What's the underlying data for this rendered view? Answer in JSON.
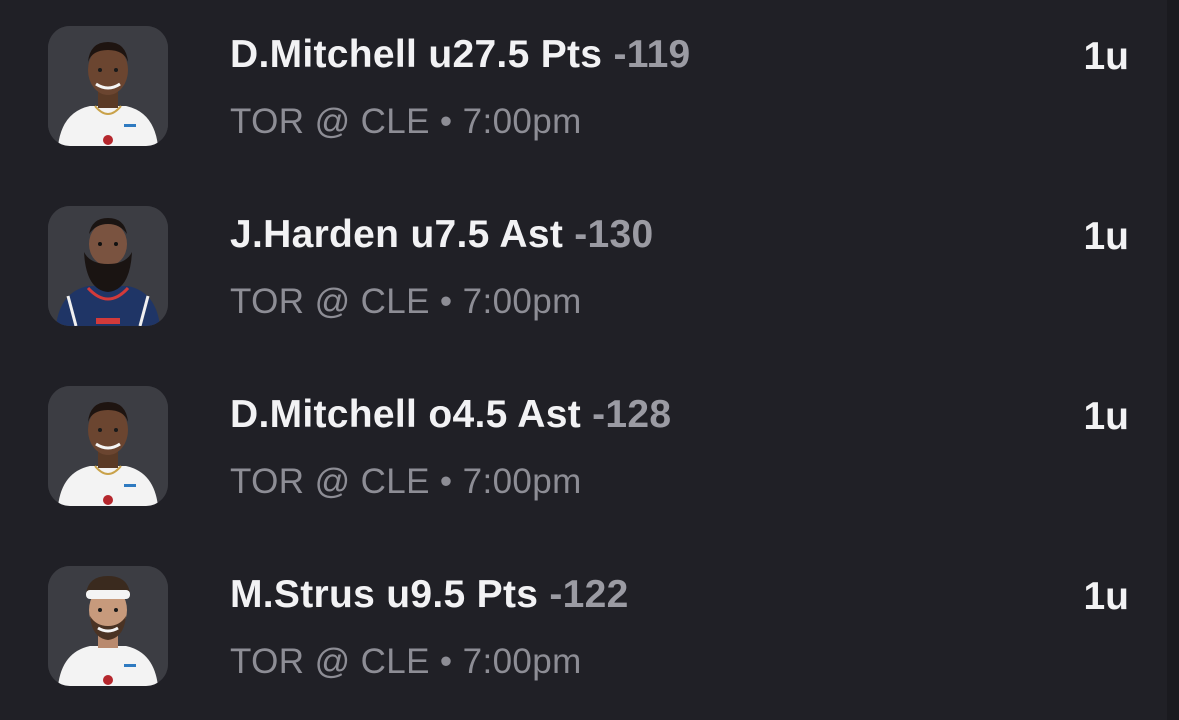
{
  "colors": {
    "background": "#202026",
    "title_text": "#f2f2f4",
    "odds_text": "#9b9ba3",
    "subtitle_text": "#8d8d95",
    "avatar_bg": "#3c3d43"
  },
  "bets": [
    {
      "player": "D.Mitchell",
      "line": "u27.5 Pts",
      "odds": "-119",
      "matchup": "TOR @ CLE",
      "separator": "•",
      "time": "7:00pm",
      "units": "1u",
      "avatar_icon": "player-headshot-icon"
    },
    {
      "player": "J.Harden",
      "line": "u7.5 Ast",
      "odds": "-130",
      "matchup": "TOR @ CLE",
      "separator": "•",
      "time": "7:00pm",
      "units": "1u",
      "avatar_icon": "player-headshot-icon"
    },
    {
      "player": "D.Mitchell",
      "line": "o4.5 Ast",
      "odds": "-128",
      "matchup": "TOR @ CLE",
      "separator": "•",
      "time": "7:00pm",
      "units": "1u",
      "avatar_icon": "player-headshot-icon"
    },
    {
      "player": "M.Strus",
      "line": "u9.5 Pts",
      "odds": "-122",
      "matchup": "TOR @ CLE",
      "separator": "•",
      "time": "7:00pm",
      "units": "1u",
      "avatar_icon": "player-headshot-icon"
    }
  ]
}
